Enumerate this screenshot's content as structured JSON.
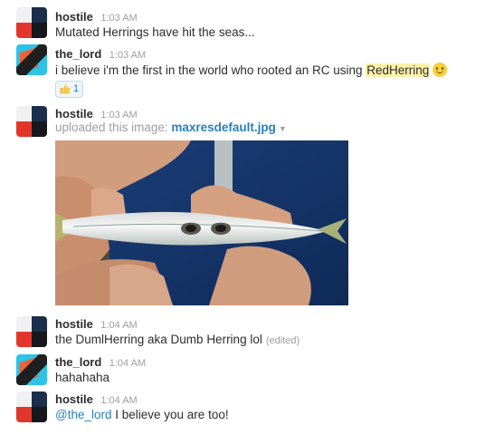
{
  "messages": [
    {
      "user": "hostile",
      "time": "1:03 AM",
      "text": "Mutated Herrings have hit the seas..."
    },
    {
      "user": "the_lord",
      "time": "1:03 AM",
      "text_before": "i believe i'm the first in the world who rooted an RC using ",
      "highlight": "RedHerring",
      "reaction": {
        "icon": "thumbs-up-icon",
        "count": "1"
      }
    },
    {
      "user": "hostile",
      "time": "1:03 AM",
      "upload_prefix": "uploaded this image: ",
      "file_name": "maxresdefault.jpg",
      "image": "fish-photo"
    },
    {
      "user": "hostile",
      "time": "1:04 AM",
      "text": "the DumlHerring aka Dumb Herring lol",
      "edited": "(edited)"
    },
    {
      "user": "the_lord",
      "time": "1:04 AM",
      "text": "hahahaha"
    },
    {
      "user": "hostile",
      "time": "1:04 AM",
      "mention": "@the_lord",
      "text": " I believe you are too!"
    }
  ],
  "colors": {
    "link": "#2a80b9",
    "highlight": "#fdf2a8",
    "timestamp": "#9e9ea6"
  }
}
